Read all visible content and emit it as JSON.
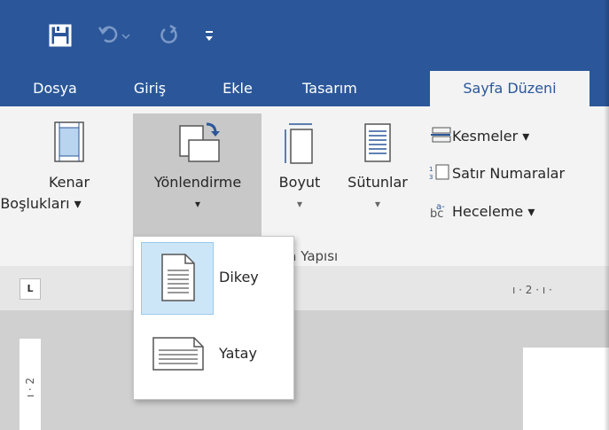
{
  "qat": {
    "save_icon": "save-icon",
    "undo_icon": "undo-icon",
    "redo_icon": "redo-icon",
    "customize_icon": "customize-qat-icon"
  },
  "tabs": [
    {
      "label": "Dosya"
    },
    {
      "label": "Giriş"
    },
    {
      "label": "Ekle"
    },
    {
      "label": "Tasarım"
    },
    {
      "label": "Sayfa Düzeni",
      "active": true
    }
  ],
  "ribbon": {
    "kenar": {
      "line1": "Kenar",
      "line2": "Boşlukları ▾"
    },
    "yonlendirme": {
      "label": "Yönlendirme",
      "arrow": "▾"
    },
    "boyut": {
      "label": "Boyut",
      "arrow": "▾"
    },
    "sutunlar": {
      "label": "Sütunlar",
      "arrow": "▾"
    },
    "kesmeler": "Kesmeler ▾",
    "satir_numaralari": "Satır Numaralar",
    "heceleme": "Heceleme ▾",
    "group_label": "fa Yapısı"
  },
  "ruler": {
    "corner": "L",
    "ticks": "ı · 2 · ı ·",
    "vticks": "ı · 2"
  },
  "orientation_menu": {
    "items": [
      {
        "label": "Dikey",
        "selected": true
      },
      {
        "label": "Yatay",
        "selected": false
      }
    ]
  },
  "colors": {
    "accent": "#2b579a",
    "ribbon_bg": "#f3f3f3",
    "hover_bg": "#c8c8c8",
    "selected_bg": "#cde6f7"
  }
}
